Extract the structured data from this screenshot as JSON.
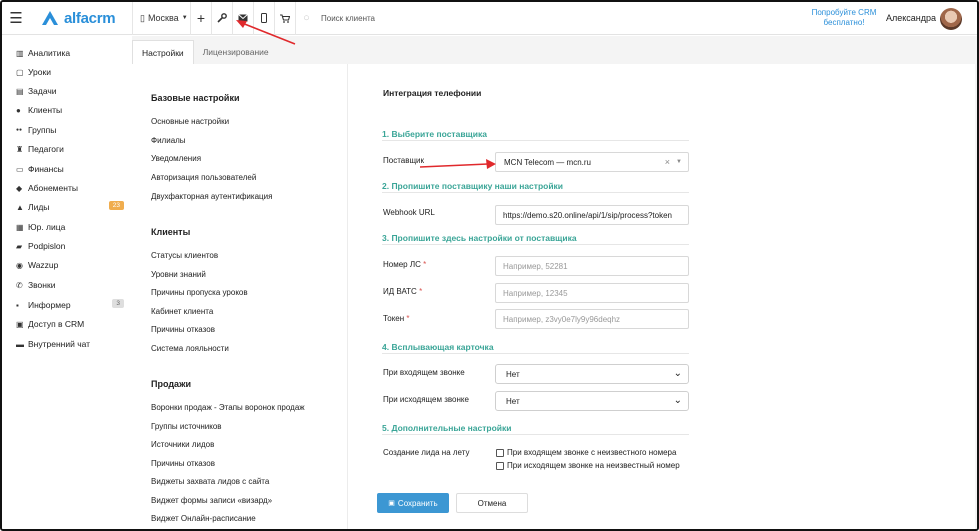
{
  "topbar": {
    "logo_text": "alfacrm",
    "city": "Москва",
    "search_placeholder": "Поиск клиента",
    "try_crm": "Попробуйте CRM бесплатно!",
    "user_name": "Александра"
  },
  "sidebar": {
    "items": [
      {
        "label": "Аналитика",
        "icon": "analytics-icon"
      },
      {
        "label": "Уроки",
        "icon": "calendar-icon"
      },
      {
        "label": "Задачи",
        "icon": "tasks-icon"
      },
      {
        "label": "Клиенты",
        "icon": "user-icon"
      },
      {
        "label": "Группы",
        "icon": "users-icon"
      },
      {
        "label": "Педагоги",
        "icon": "teacher-icon"
      },
      {
        "label": "Финансы",
        "icon": "money-icon"
      },
      {
        "label": "Абонементы",
        "icon": "tag-icon"
      },
      {
        "label": "Лиды",
        "icon": "leads-icon",
        "badge": "23"
      },
      {
        "label": "Юр. лица",
        "icon": "building-icon"
      },
      {
        "label": "Podpislon",
        "icon": "document-icon"
      },
      {
        "label": "Wazzup",
        "icon": "whatsapp-icon"
      },
      {
        "label": "Звонки",
        "icon": "phone-icon"
      },
      {
        "label": "Информер",
        "icon": "informer-icon",
        "badge": "3"
      },
      {
        "label": "Доступ в CRM",
        "icon": "lock-icon"
      },
      {
        "label": "Внутренний чат",
        "icon": "chat-icon"
      }
    ]
  },
  "tabs": [
    "Настройки",
    "Лицензирование"
  ],
  "settings_menu": {
    "sections": [
      {
        "title": "Базовые настройки",
        "links": [
          "Основные настройки",
          "Филиалы",
          "Уведомления",
          "Авторизация пользователей",
          "Двухфакторная аутентификация"
        ]
      },
      {
        "title": "Клиенты",
        "links": [
          "Статусы клиентов",
          "Уровни знаний",
          "Причины пропуска уроков",
          "Кабинет клиента",
          "Причины отказов",
          "Система лояльности"
        ]
      },
      {
        "title": "Продажи",
        "links": [
          "Воронки продаж - Этапы воронок продаж",
          "Группы источников",
          "Источники лидов",
          "Причины отказов",
          "Виджеты захвата лидов с сайта",
          "Виджет формы записи «визард»",
          "Виджет Онлайн-расписание"
        ]
      }
    ]
  },
  "telephony": {
    "title": "Интеграция телефонии",
    "step1": "1. Выберите поставщика",
    "provider_label": "Поставщик",
    "provider_value": "MCN Telecom — mcn.ru",
    "step2": "2. Пропишите поставщику наши настройки",
    "webhook_label": "Webhook URL",
    "webhook_value": "https://demo.s20.online/api/1/sip/process?token",
    "step3": "3. Пропишите здесь настройки от поставщика",
    "ls_label": "Номер ЛС",
    "ls_placeholder": "Например, 52281",
    "vats_label": "ИД ВАТС",
    "vats_placeholder": "Например, 12345",
    "token_label": "Токен",
    "token_placeholder": "Например, z3vy0e7ly9y96deqhz",
    "step4": "4. Всплывающая карточка",
    "incoming_label": "При входящем звонке",
    "incoming_value": "Нет",
    "outgoing_label": "При исходящем звонке",
    "outgoing_value": "Нет",
    "step5": "5. Дополнительные настройки",
    "create_lead_label": "Создание лида на лету",
    "chk_incoming": "При входящем звонке с неизвестного номера",
    "chk_outgoing": "При исходящем звонке на неизвестный номер",
    "save": "Сохранить",
    "cancel": "Отмена",
    "required_mark": "*"
  },
  "colors": {
    "accent": "#2a8fd9",
    "step": "#3aa597",
    "arrow": "#e0292c",
    "save": "#3c97d3"
  }
}
